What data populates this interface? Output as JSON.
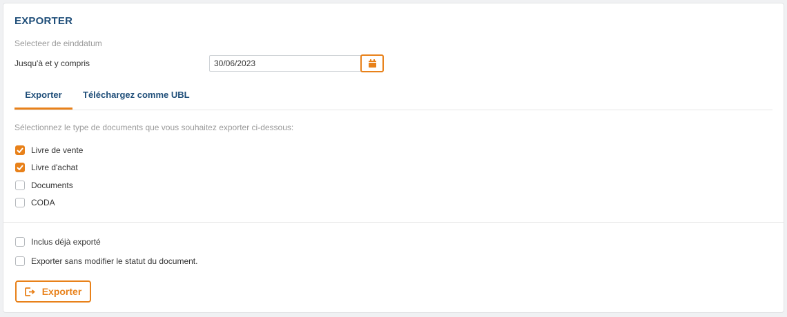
{
  "header": {
    "title": "EXPORTER",
    "subtitle": "Selecteer de einddatum"
  },
  "date": {
    "label": "Jusqu'à et y compris",
    "value": "30/06/2023",
    "calendar_icon": "calendar-icon"
  },
  "tabs": [
    {
      "label": "Exporter",
      "active": true
    },
    {
      "label": "Téléchargez comme UBL",
      "active": false
    }
  ],
  "instructions": "Sélectionnez le type de documents que vous souhaitez exporter ci-dessous:",
  "document_types": [
    {
      "label": "Livre de vente",
      "checked": true
    },
    {
      "label": "Livre d'achat",
      "checked": true
    },
    {
      "label": "Documents",
      "checked": false
    },
    {
      "label": "CODA",
      "checked": false
    }
  ],
  "options": [
    {
      "label": "Inclus déjà exporté",
      "checked": false
    },
    {
      "label": "Exporter sans modifier le statut du document.",
      "checked": false
    }
  ],
  "export_button": {
    "label": "Exporter",
    "icon": "export-icon"
  },
  "colors": {
    "accent": "#e8811a",
    "title": "#1f4e79"
  }
}
